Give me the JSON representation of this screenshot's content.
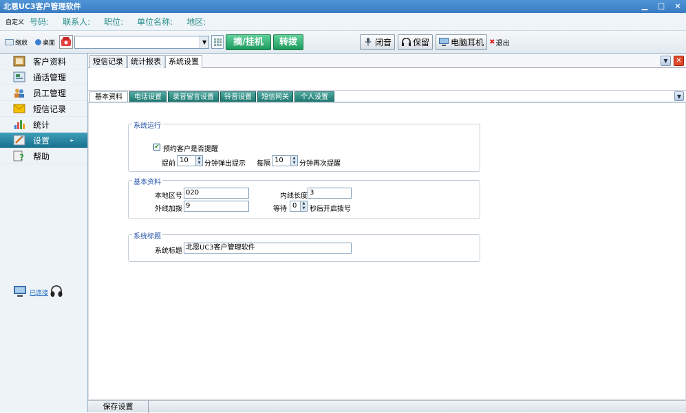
{
  "window": {
    "title": "北恩UC3客户管理软件",
    "min": "▁",
    "max": "□",
    "close": "×"
  },
  "infobar": {
    "custom": "自定义",
    "phone": "号码:",
    "contact": "联系人:",
    "position": "职位:",
    "company": "单位名称:",
    "region": "地区:"
  },
  "toolbar": {
    "minimize": "缩放",
    "desktop": "桌面",
    "dial_value": "",
    "pickup_hangup": "摘/挂机",
    "transfer": "转拨",
    "mute": "闭音",
    "hold": "保留",
    "pc_headset": "电脑耳机",
    "exit": "退出"
  },
  "sidebar": {
    "items": [
      {
        "label": "客户资料",
        "icon": "customer-icon"
      },
      {
        "label": "通话管理",
        "icon": "call-icon"
      },
      {
        "label": "员工管理",
        "icon": "staff-icon"
      },
      {
        "label": "短信记录",
        "icon": "sms-icon"
      },
      {
        "label": "统计",
        "icon": "stats-icon"
      },
      {
        "label": "设置",
        "icon": "settings-icon"
      },
      {
        "label": "帮助",
        "icon": "help-icon"
      }
    ],
    "status": "已连接"
  },
  "top_tabs": [
    "短信记录",
    "统计报表",
    "系统设置"
  ],
  "sub_tabs": [
    "基本资料",
    "电话设置",
    "录音留言设置",
    "铃音设置",
    "短信网关",
    "个人设置"
  ],
  "settings": {
    "run": {
      "legend": "系统运行",
      "remind_label": "预约客户是否提醒",
      "remind_checked": true,
      "advance_label": "提前",
      "advance_value": "10",
      "advance_suffix": "分钟弹出提示",
      "every_label": "每隔",
      "every_value": "10",
      "every_suffix": "分钟再次提醒"
    },
    "basic": {
      "legend": "基本资料",
      "area_code_label": "本地区号",
      "area_code_value": "020",
      "ext_len_label": "内线长度",
      "ext_len_value": "3",
      "outside_label": "外线加拨",
      "outside_value": "9",
      "wait_label": "等待",
      "wait_value": "0",
      "wait_suffix": "秒后开启拨号"
    },
    "title": {
      "legend": "系统标题",
      "label": "系统标题",
      "value": "北恩UC3客户管理软件"
    }
  },
  "footer": {
    "save": "保存设置"
  }
}
